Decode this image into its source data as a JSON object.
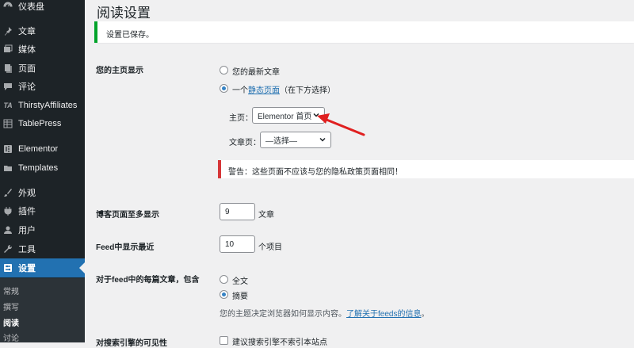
{
  "sidebar": {
    "items": [
      {
        "label": "仪表盘",
        "icon": "dashboard-icon"
      },
      {
        "label": "文章",
        "icon": "pin-icon"
      },
      {
        "label": "媒体",
        "icon": "media-icon"
      },
      {
        "label": "页面",
        "icon": "page-icon"
      },
      {
        "label": "评论",
        "icon": "comment-icon"
      },
      {
        "label": "ThirstyAffiliates",
        "icon": "ta-icon"
      },
      {
        "label": "TablePress",
        "icon": "table-icon"
      },
      {
        "label": "Elementor",
        "icon": "elementor-icon"
      },
      {
        "label": "Templates",
        "icon": "folder-icon"
      },
      {
        "label": "外观",
        "icon": "brush-icon"
      },
      {
        "label": "插件",
        "icon": "plugin-icon"
      },
      {
        "label": "用户",
        "icon": "user-icon"
      },
      {
        "label": "工具",
        "icon": "wrench-icon"
      },
      {
        "label": "设置",
        "icon": "settings-icon"
      }
    ],
    "submenu": [
      "常规",
      "撰写",
      "阅读",
      "讨论"
    ]
  },
  "page": {
    "title": "阅读设置",
    "notice": "设置已保存。"
  },
  "homepage": {
    "label": "您的主页显示",
    "option_latest": "您的最新文章",
    "option_static_prefix": "一个",
    "option_static_link": "静态页面",
    "option_static_suffix": "（在下方选择）",
    "front_label": "主页：",
    "front_value": "Elementor 首页",
    "posts_label": "文章页：",
    "posts_value": "—选择—",
    "warning": "警告：这些页面不应该与您的隐私政策页面相同！"
  },
  "blog_pages": {
    "label": "博客页面至多显示",
    "value": "9",
    "unit": "文章"
  },
  "feed_items": {
    "label": "Feed中显示最近",
    "value": "10",
    "unit": "个项目"
  },
  "feed_content": {
    "label": "对于feed中的每篇文章，包含",
    "option_full": "全文",
    "option_summary": "摘要",
    "desc_prefix": "您的主题决定浏览器如何显示内容。",
    "desc_link": "了解关于feeds的信息",
    "desc_suffix": "。"
  },
  "search_visibility": {
    "label": "对搜索引擎的可见性",
    "checkbox_label": "建议搜索引擎不索引本站点"
  },
  "colors": {
    "sidebar_bg": "#1d2327",
    "active": "#2271b1",
    "notice_border": "#00a32a",
    "warning_border": "#d63638",
    "annotation_arrow": "#e02020"
  }
}
